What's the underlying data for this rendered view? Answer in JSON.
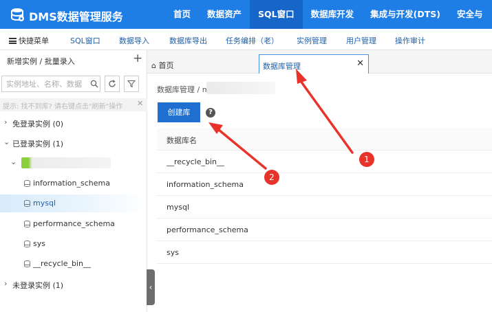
{
  "header": {
    "app_title": "DMS数据管理服务",
    "nav": [
      {
        "label": "首页",
        "active": false
      },
      {
        "label": "数据资产",
        "active": false
      },
      {
        "label": "SQL窗口",
        "active": true
      },
      {
        "label": "数据库开发",
        "active": false
      },
      {
        "label": "集成与开发(DTS)",
        "active": false
      },
      {
        "label": "安全与",
        "active": false
      }
    ],
    "brand_color": "#1f7ee6"
  },
  "toolbar": {
    "items": [
      "快捷菜单",
      "SQL窗口",
      "数据导入",
      "数据库导出",
      "任务编排（老）",
      "实例管理",
      "用户管理",
      "操作审计"
    ]
  },
  "sidebar": {
    "header": "新增实例 / 批量录入",
    "search_placeholder": "实例地址、名称、数据",
    "hint": "提示: 找不到库? 请右键点击\"刷新\"操作",
    "groups": {
      "free_login": "免登录实例 (0)",
      "logged_in": "已登录实例 (1)",
      "not_logged_in": "未登录实例 (1)"
    },
    "databases": [
      {
        "name": "information_schema",
        "selected": false
      },
      {
        "name": "mysql",
        "selected": true
      },
      {
        "name": "performance_schema",
        "selected": false
      },
      {
        "name": "sys",
        "selected": false
      },
      {
        "name": "__recycle_bin__",
        "selected": false
      }
    ]
  },
  "tabs": {
    "home": "首页",
    "db_manage": "数据库管理"
  },
  "main": {
    "breadcrumb": "数据库管理 / m",
    "create_button": "创建库",
    "help": "?",
    "table_header": "数据库名",
    "rows": [
      "__recycle_bin__",
      "information_schema",
      "mysql",
      "performance_schema",
      "sys"
    ]
  },
  "annotations": {
    "badge1": "1",
    "badge2": "2",
    "arrow_color": "#e8332b"
  }
}
